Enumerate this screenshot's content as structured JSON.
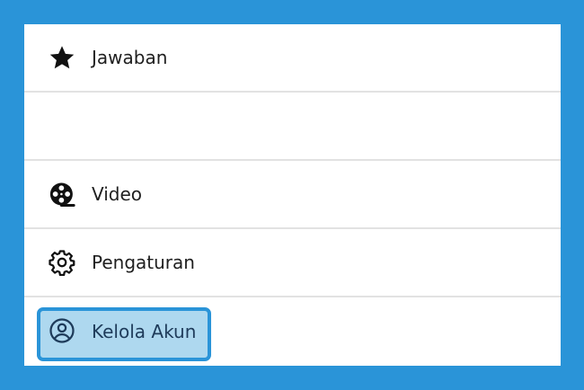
{
  "menu": {
    "items": [
      {
        "label": "Jawaban",
        "icon": "star-icon"
      },
      {
        "label": "",
        "icon": ""
      },
      {
        "label": "Video",
        "icon": "film-reel-icon"
      },
      {
        "label": "Pengaturan",
        "icon": "gear-icon"
      },
      {
        "label": "Kelola Akun",
        "icon": "account-circle-icon",
        "selected": true
      }
    ]
  },
  "colors": {
    "background": "#2a94d8",
    "highlight_fill": "#aed8ef",
    "highlight_border": "#2a94d8"
  }
}
